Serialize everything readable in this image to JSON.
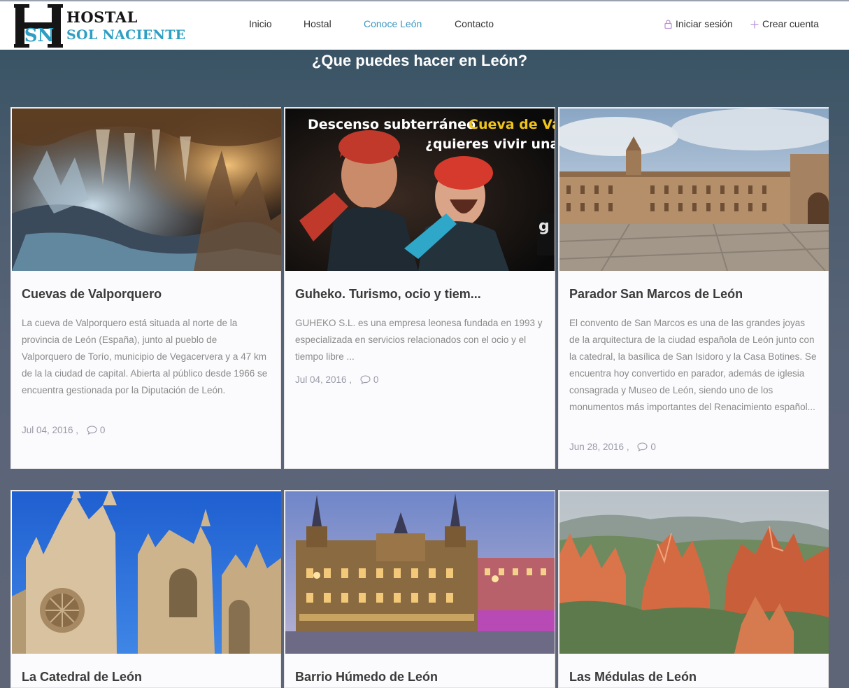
{
  "brand": {
    "line1": "HOSTAL",
    "line2": "SOL NACIENTE",
    "mark": "H",
    "mark_sub": "SN"
  },
  "nav": {
    "items": [
      {
        "label": "Inicio"
      },
      {
        "label": "Hostal"
      },
      {
        "label": "Conoce León"
      },
      {
        "label": "Contacto"
      }
    ],
    "login": "Iniciar sesión",
    "register": "Crear cuenta"
  },
  "page": {
    "title": "¿Que puedes hacer en León?"
  },
  "cards": [
    {
      "title": "Cuevas de Valporquero",
      "excerpt": "La cueva de Valporquero está situada al norte de la provincia de León (España), junto al pueblo de Valporquero de Torío, municipio de Vegacervera y a 47 km de la la ciudad de capital. Abierta al público desde 1966 se encuentra gestionada por la Diputación de León.",
      "date": "Jul 04, 2016 ,",
      "comments": "0",
      "image": "cave"
    },
    {
      "title": "Guheko. Turismo, ocio y tiem...",
      "excerpt": "GUHEKO S.L. es una empresa leonesa fundada en 1993 y especializada en servicios relacionados con el ocio y el tiempo libre ...",
      "date": "Jul 04, 2016 ,",
      "comments": "0",
      "image": "caving-ad",
      "image_text_1a": "Descenso subterráneo",
      "image_text_1b": "Cueva de Va",
      "image_text_2": "¿quieres vivir una"
    },
    {
      "title": "Parador San Marcos de León",
      "excerpt": "El convento de San Marcos es una de las grandes joyas de la arquitectura de la ciudad española de León junto con la catedral, la basílica de San Isidoro y la Casa Botines. Se encuentra hoy convertido en parador, además de iglesia consagrada y Museo de León, siendo uno de los monumentos más importantes del Renacimiento español...",
      "date": "Jun 28, 2016 ,",
      "comments": "0",
      "image": "san-marcos"
    },
    {
      "title": "La Catedral de León",
      "image": "cathedral"
    },
    {
      "title": "Barrio Húmedo de León",
      "image": "plaza-mayor"
    },
    {
      "title": "Las Médulas de León",
      "image": "medulas"
    }
  ],
  "colors": {
    "accent": "#3c96c0",
    "brand_blue": "#2d9fc3",
    "background": "#4b5c6e"
  }
}
